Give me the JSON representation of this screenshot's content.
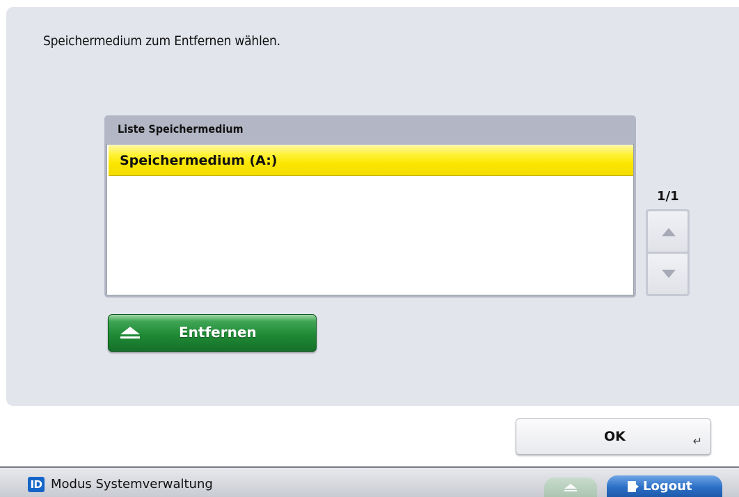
{
  "dialog": {
    "instruction": "Speichermedium zum Entfernen wählen.",
    "list": {
      "header": "Liste Speichermedium",
      "items": [
        {
          "label": "Speichermedium (A:)",
          "selected": true
        }
      ],
      "page_indicator": "1/1"
    },
    "eject_button": {
      "label": "Entfernen",
      "icon": "eject-icon",
      "color": "#1f8a35"
    },
    "ok_button": {
      "label": "OK",
      "icon": "enter-icon"
    }
  },
  "status_bar": {
    "id_badge": "ID",
    "mode": "Modus Systemverwaltung",
    "eject_icon": "eject-icon",
    "logout_label": "Logout",
    "logout_icon": "logout-door-icon",
    "logout_color": "#2c6fc6"
  },
  "colors": {
    "panel_bg": "#e3e5ed",
    "selected_row": "#fbe600"
  }
}
